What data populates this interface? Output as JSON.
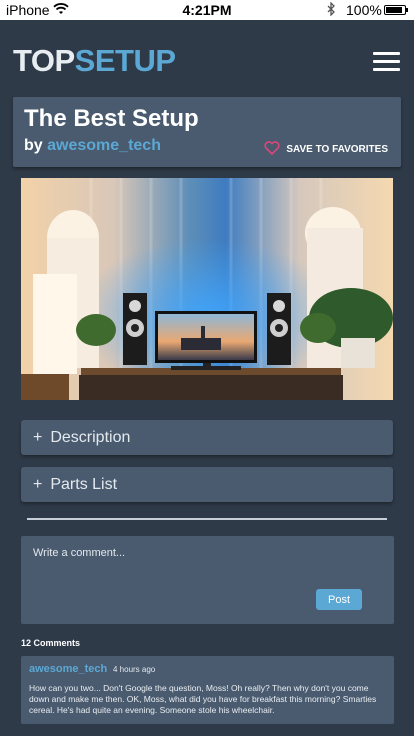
{
  "status_bar": {
    "carrier": "iPhone",
    "time": "4:21PM",
    "battery": "100%"
  },
  "header": {
    "brand_top": "TOP",
    "brand_setup": "SETUP"
  },
  "setup": {
    "title": "The Best Setup",
    "by": "by",
    "author": "awesome_tech",
    "save_label": "SAVE TO FAVORITES"
  },
  "sections": {
    "description": "Description",
    "parts_list": "Parts List",
    "expand_symbol": "+"
  },
  "comment_form": {
    "placeholder": "Write a comment...",
    "post_label": "Post"
  },
  "comments": {
    "count_label": "12 Comments",
    "items": [
      {
        "author": "awesome_tech",
        "time": "4 hours ago",
        "body": "How can you two... Don't Google the question, Moss! Oh really? Then why don't you come down and make me then. OK, Moss, what did you have for breakfast this morning? Smarties cereal. He's had quite an evening. Someone stole his wheelchair."
      }
    ]
  },
  "colors": {
    "background": "#2f3a48",
    "card": "#4a5b6f",
    "accent": "#5ba8d4",
    "heart": "#e0457b"
  }
}
